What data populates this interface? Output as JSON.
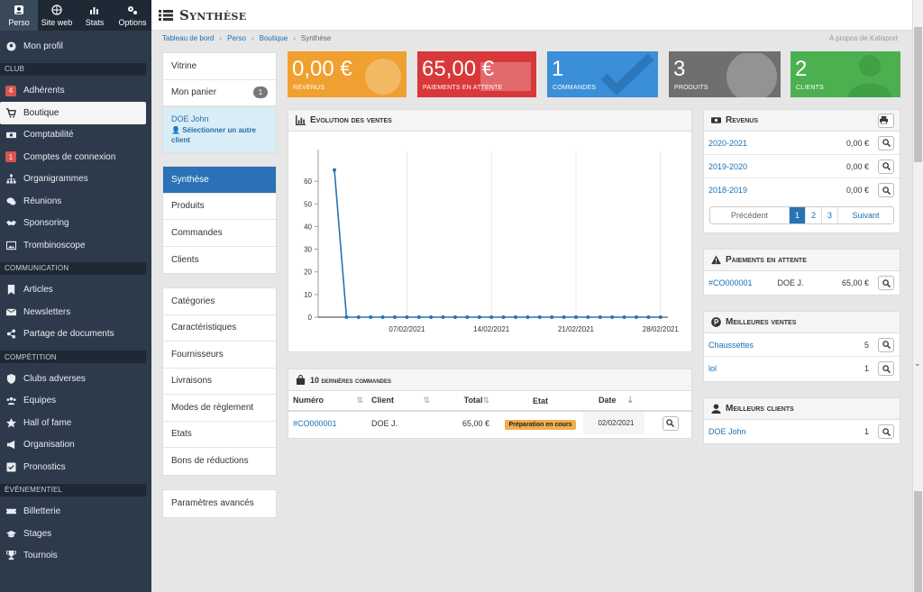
{
  "topnav": [
    {
      "label": "Perso",
      "icon": "user-icon"
    },
    {
      "label": "Site web",
      "icon": "globe-icon"
    },
    {
      "label": "Stats",
      "icon": "chart-icon"
    },
    {
      "label": "Options",
      "icon": "gears-icon"
    }
  ],
  "sidebar": {
    "profile": "Mon profil",
    "club_title": "CLUB",
    "club": [
      {
        "label": "Adhérents",
        "badge": "4"
      },
      {
        "label": "Boutique"
      },
      {
        "label": "Comptabilité"
      },
      {
        "label": "Comptes de connexion",
        "badge": "1"
      },
      {
        "label": "Organigrammes"
      },
      {
        "label": "Réunions"
      },
      {
        "label": "Sponsoring"
      },
      {
        "label": "Trombinoscope"
      }
    ],
    "communication_title": "COMMUNICATION",
    "communication": [
      {
        "label": "Articles"
      },
      {
        "label": "Newsletters"
      },
      {
        "label": "Partage de documents"
      }
    ],
    "competition_title": "COMPÉTITION",
    "competition": [
      {
        "label": "Clubs adverses"
      },
      {
        "label": "Equipes"
      },
      {
        "label": "Hall of fame"
      },
      {
        "label": "Organisation"
      },
      {
        "label": "Pronostics"
      }
    ],
    "evenementiel_title": "ÉVÉNEMENTIEL",
    "evenementiel": [
      {
        "label": "Billetterie"
      },
      {
        "label": "Stages"
      },
      {
        "label": "Tournois"
      }
    ]
  },
  "header": {
    "title": "Synthèse"
  },
  "breadcrumb": [
    "Tableau de bord",
    "Perso",
    "Boutique",
    "Synthèse"
  ],
  "about": "A propos de Kalisport",
  "leftmenu": {
    "vitrine": "Vitrine",
    "panier": "Mon panier",
    "panier_count": "1",
    "client_name": "DOE John",
    "client_change": "Sélectionner un autre client",
    "group1": [
      "Synthèse",
      "Produits",
      "Commandes",
      "Clients"
    ],
    "group2": [
      "Catégories",
      "Caractéristiques",
      "Fournisseurs",
      "Livraisons",
      "Modes de règlement",
      "Etats",
      "Bons de réductions"
    ],
    "group3": [
      "Paramètres avancés"
    ]
  },
  "tiles": [
    {
      "value": "0,00 €",
      "label": "REVENUS",
      "color": "#f0a030"
    },
    {
      "value": "65,00 €",
      "label": "PAIEMENTS EN ATTENTE",
      "color": "#d9383a"
    },
    {
      "value": "1",
      "label": "COMMANDES",
      "color": "#3a8fd8"
    },
    {
      "value": "3",
      "label": "PRODUITS",
      "color": "#6f6f6f"
    },
    {
      "value": "2",
      "label": "CLIENTS",
      "color": "#4cb050"
    }
  ],
  "evolution": {
    "title": "Evolution des ventes"
  },
  "chart_data": {
    "type": "line",
    "title": "Evolution des ventes",
    "xlabel": "",
    "ylabel": "",
    "ylim": [
      0,
      70
    ],
    "yticks": [
      0,
      10,
      20,
      30,
      40,
      50,
      60
    ],
    "xticks": [
      "07/02/2021",
      "14/02/2021",
      "21/02/2021",
      "28/02/2021"
    ],
    "x": [
      "01/02/2021",
      "02/02/2021",
      "03/02/2021",
      "04/02/2021",
      "05/02/2021",
      "06/02/2021",
      "07/02/2021",
      "08/02/2021",
      "09/02/2021",
      "10/02/2021",
      "11/02/2021",
      "12/02/2021",
      "13/02/2021",
      "14/02/2021",
      "15/02/2021",
      "16/02/2021",
      "17/02/2021",
      "18/02/2021",
      "19/02/2021",
      "20/02/2021",
      "21/02/2021",
      "22/02/2021",
      "23/02/2021",
      "24/02/2021",
      "25/02/2021",
      "26/02/2021",
      "27/02/2021",
      "28/02/2021"
    ],
    "values": [
      65,
      0,
      0,
      0,
      0,
      0,
      0,
      0,
      0,
      0,
      0,
      0,
      0,
      0,
      0,
      0,
      0,
      0,
      0,
      0,
      0,
      0,
      0,
      0,
      0,
      0,
      0,
      0
    ],
    "color": "#2a72b5"
  },
  "orders": {
    "title": "10 dernières commandes",
    "columns": [
      "Numéro",
      "Client",
      "Total",
      "Etat",
      "Date"
    ],
    "rows": [
      {
        "num": "#CO000001",
        "client": "DOE J.",
        "total": "65,00 €",
        "etat": "Préparation en cours",
        "date": "02/02/2021"
      }
    ]
  },
  "revenus": {
    "title": "Revenus",
    "rows": [
      {
        "season": "2020-2021",
        "amount": "0,00 €"
      },
      {
        "season": "2019-2020",
        "amount": "0,00 €"
      },
      {
        "season": "2018-2019",
        "amount": "0,00 €"
      }
    ],
    "prev": "Précédent",
    "pages": [
      "1",
      "2",
      "3"
    ],
    "next": "Suivant"
  },
  "attente": {
    "title": "Paiements en attente",
    "rows": [
      {
        "num": "#CO000001",
        "client": "DOE J.",
        "amount": "65,00 €"
      }
    ]
  },
  "ventes": {
    "title": "Meilleures ventes",
    "rows": [
      {
        "label": "Chaussettes",
        "count": "5"
      },
      {
        "label": "lol",
        "count": "1"
      }
    ]
  },
  "clients": {
    "title": "Meilleurs clients",
    "rows": [
      {
        "label": "DOE John",
        "count": "1"
      }
    ]
  }
}
